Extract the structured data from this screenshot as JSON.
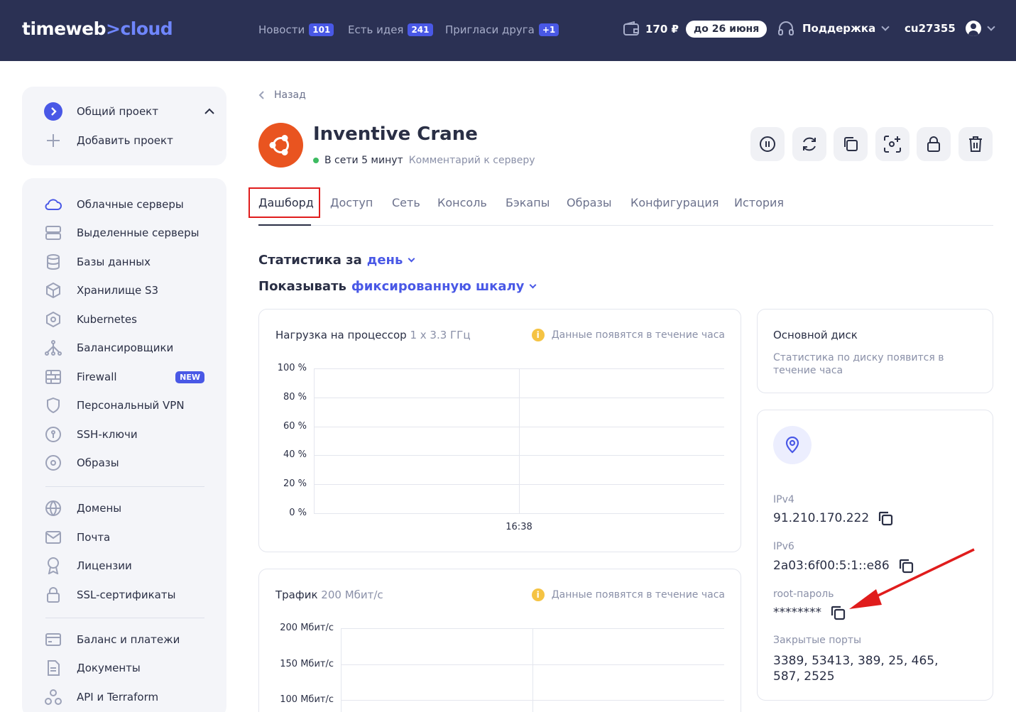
{
  "header": {
    "logo_main": "timeweb",
    "logo_sep": ">",
    "logo_sub": "cloud",
    "nav": [
      {
        "label": "Новости",
        "badge": "101"
      },
      {
        "label": "Есть идея",
        "badge": "241"
      },
      {
        "label": "Пригласи друга",
        "badge": "+1"
      }
    ],
    "balance": "170 ₽",
    "balance_until": "до 26 июня",
    "support": "Поддержка",
    "user": "cu27355"
  },
  "projects": {
    "current": "Общий проект",
    "add": "Добавить проект"
  },
  "sidebar": {
    "items": [
      {
        "label": "Облачные серверы",
        "icon": "cloud-icon"
      },
      {
        "label": "Выделенные серверы",
        "icon": "server-icon"
      },
      {
        "label": "Базы данных",
        "icon": "database-icon"
      },
      {
        "label": "Хранилище S3",
        "icon": "cube-icon"
      },
      {
        "label": "Kubernetes",
        "icon": "kubernetes-icon"
      },
      {
        "label": "Балансировщики",
        "icon": "balancer-icon"
      },
      {
        "label": "Firewall",
        "icon": "firewall-icon",
        "badge": "NEW"
      },
      {
        "label": "Персональный VPN",
        "icon": "shield-icon"
      },
      {
        "label": "SSH-ключи",
        "icon": "key-icon"
      },
      {
        "label": "Образы",
        "icon": "disc-icon"
      },
      {
        "label": "Домены",
        "icon": "globe-icon"
      },
      {
        "label": "Почта",
        "icon": "mail-icon"
      },
      {
        "label": "Лицензии",
        "icon": "license-icon"
      },
      {
        "label": "SSL-сертификаты",
        "icon": "lock-icon"
      },
      {
        "label": "Баланс и платежи",
        "icon": "card-icon"
      },
      {
        "label": "Документы",
        "icon": "document-icon"
      },
      {
        "label": "API и Terraform",
        "icon": "api-icon"
      }
    ]
  },
  "server": {
    "back": "Назад",
    "name": "Inventive Crane",
    "status": "В сети 5 минут",
    "comment": "Комментарий к серверу"
  },
  "tabs": [
    "Дашборд",
    "Доступ",
    "Сеть",
    "Консоль",
    "Бэкапы",
    "Образы",
    "Конфигурация",
    "История"
  ],
  "filters": {
    "stats_label": "Статистика за",
    "stats_value": "день",
    "show_label": "Показывать",
    "show_value": "фиксированную шкалу"
  },
  "cpu_panel": {
    "title": "Нагрузка на процессор",
    "subtitle": "1 x 3.3 ГГц",
    "note": "Данные появятся в течение часа"
  },
  "traffic_panel": {
    "title": "Трафик",
    "subtitle": "200 Мбит/с",
    "note": "Данные появятся в течение часа"
  },
  "chart_data": [
    {
      "type": "line",
      "title": "Нагрузка на процессор",
      "x": [
        "16:38"
      ],
      "yticks": [
        "100 %",
        "80 %",
        "60 %",
        "40 %",
        "20 %",
        "0 %"
      ],
      "ylim": [
        0,
        100
      ],
      "series": []
    },
    {
      "type": "line",
      "title": "Трафик",
      "yticks": [
        "200 Мбит/с",
        "150 Мбит/с",
        "100 Мбит/с"
      ],
      "series": []
    }
  ],
  "disk": {
    "title": "Основной диск",
    "note": "Статистика по диску появится в течение часа"
  },
  "network": {
    "ipv4_label": "IPv4",
    "ipv4": "91.210.170.222",
    "ipv6_label": "IPv6",
    "ipv6": "2a03:6f00:5:1::e86",
    "root_label": "root-пароль",
    "root": "********",
    "ports_label": "Закрытые порты",
    "ports": "3389, 53413, 389, 25, 465, 587, 2525"
  },
  "colors": {
    "header_bg": "#2b3154",
    "accent": "#4958e6",
    "ubuntu": "#e95420",
    "highlight": "#e01c1c",
    "online": "#3dbb61"
  }
}
